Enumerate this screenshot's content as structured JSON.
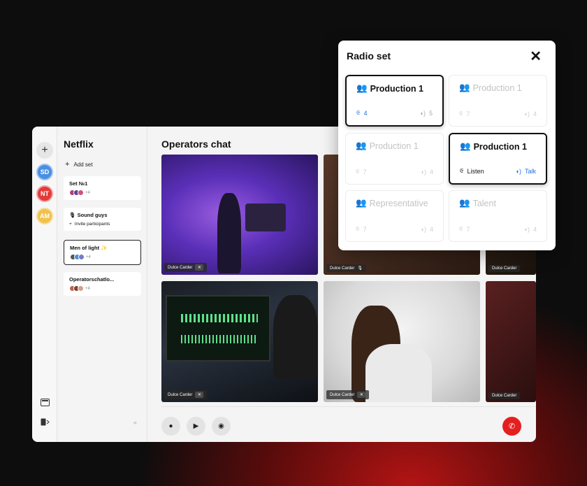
{
  "rail": {
    "add": "+",
    "avatars": [
      {
        "initials": "SD",
        "color": "#4a8fe0"
      },
      {
        "initials": "NT",
        "color": "#e23b3b"
      },
      {
        "initials": "AM",
        "color": "#efc24c"
      }
    ]
  },
  "sidebar": {
    "title": "Netflix",
    "add_set": "Add set",
    "sets": [
      {
        "name": "Set №1",
        "count": "+4"
      },
      {
        "name": "🎙 Sound guys",
        "invite": "Invite participants"
      },
      {
        "name": "Men of light ✨",
        "count": "+4"
      },
      {
        "name": "Operatorschatlo...",
        "count": "+4"
      }
    ],
    "collapse": "«"
  },
  "main": {
    "title": "Operators chat",
    "participant_name": "Dulce Carder"
  },
  "radio": {
    "title": "Radio set",
    "close": "✕",
    "channels": [
      {
        "name": "Production 1",
        "listen": "4",
        "talk": "5"
      },
      {
        "name": "Production 1",
        "listen": "7",
        "talk": "4"
      },
      {
        "name": "Production 1",
        "listen": "7",
        "talk": "4"
      },
      {
        "name": "Production 1",
        "listen": "Listen",
        "talk": "Talk"
      },
      {
        "name": "Representative",
        "listen": "7",
        "talk": "4"
      },
      {
        "name": "Talent",
        "listen": "7",
        "talk": "4"
      }
    ]
  },
  "colors": {
    "accent": "#1f6fe6",
    "end_call": "#e51f1f"
  }
}
